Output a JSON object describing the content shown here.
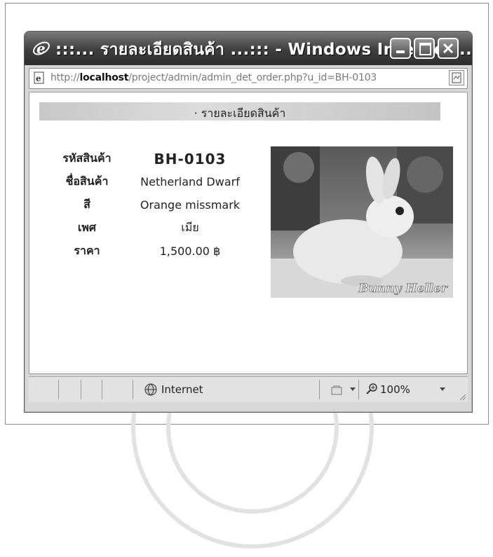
{
  "window": {
    "title": ":::... รายละเอียดสินค้า ...::: - Windows Internet...",
    "icon": "ie-logo-icon"
  },
  "address": {
    "url_prefix": "http://",
    "url_host": "localhost",
    "url_path": "/project/admin/admin_det_order.php?u_id=BH-0103"
  },
  "page": {
    "header": "· รายละเอียดสินค้า",
    "fields": [
      {
        "label": "รหัสสินค้า",
        "value": "BH-0103"
      },
      {
        "label": "ชื่อสินค้า",
        "value": "Netherland Dwarf"
      },
      {
        "label": "สี",
        "value": "Orange missmark"
      },
      {
        "label": "เพศ",
        "value": "เมีย"
      },
      {
        "label": "ราคา",
        "value": "1,500.00 ฿"
      }
    ],
    "photo_caption": "Bunny Heller"
  },
  "statusbar": {
    "zone": "Internet",
    "zoom": "100%"
  },
  "colors": {
    "titlebar": "#3e3e3e",
    "header_band": "#d0d0d0"
  }
}
